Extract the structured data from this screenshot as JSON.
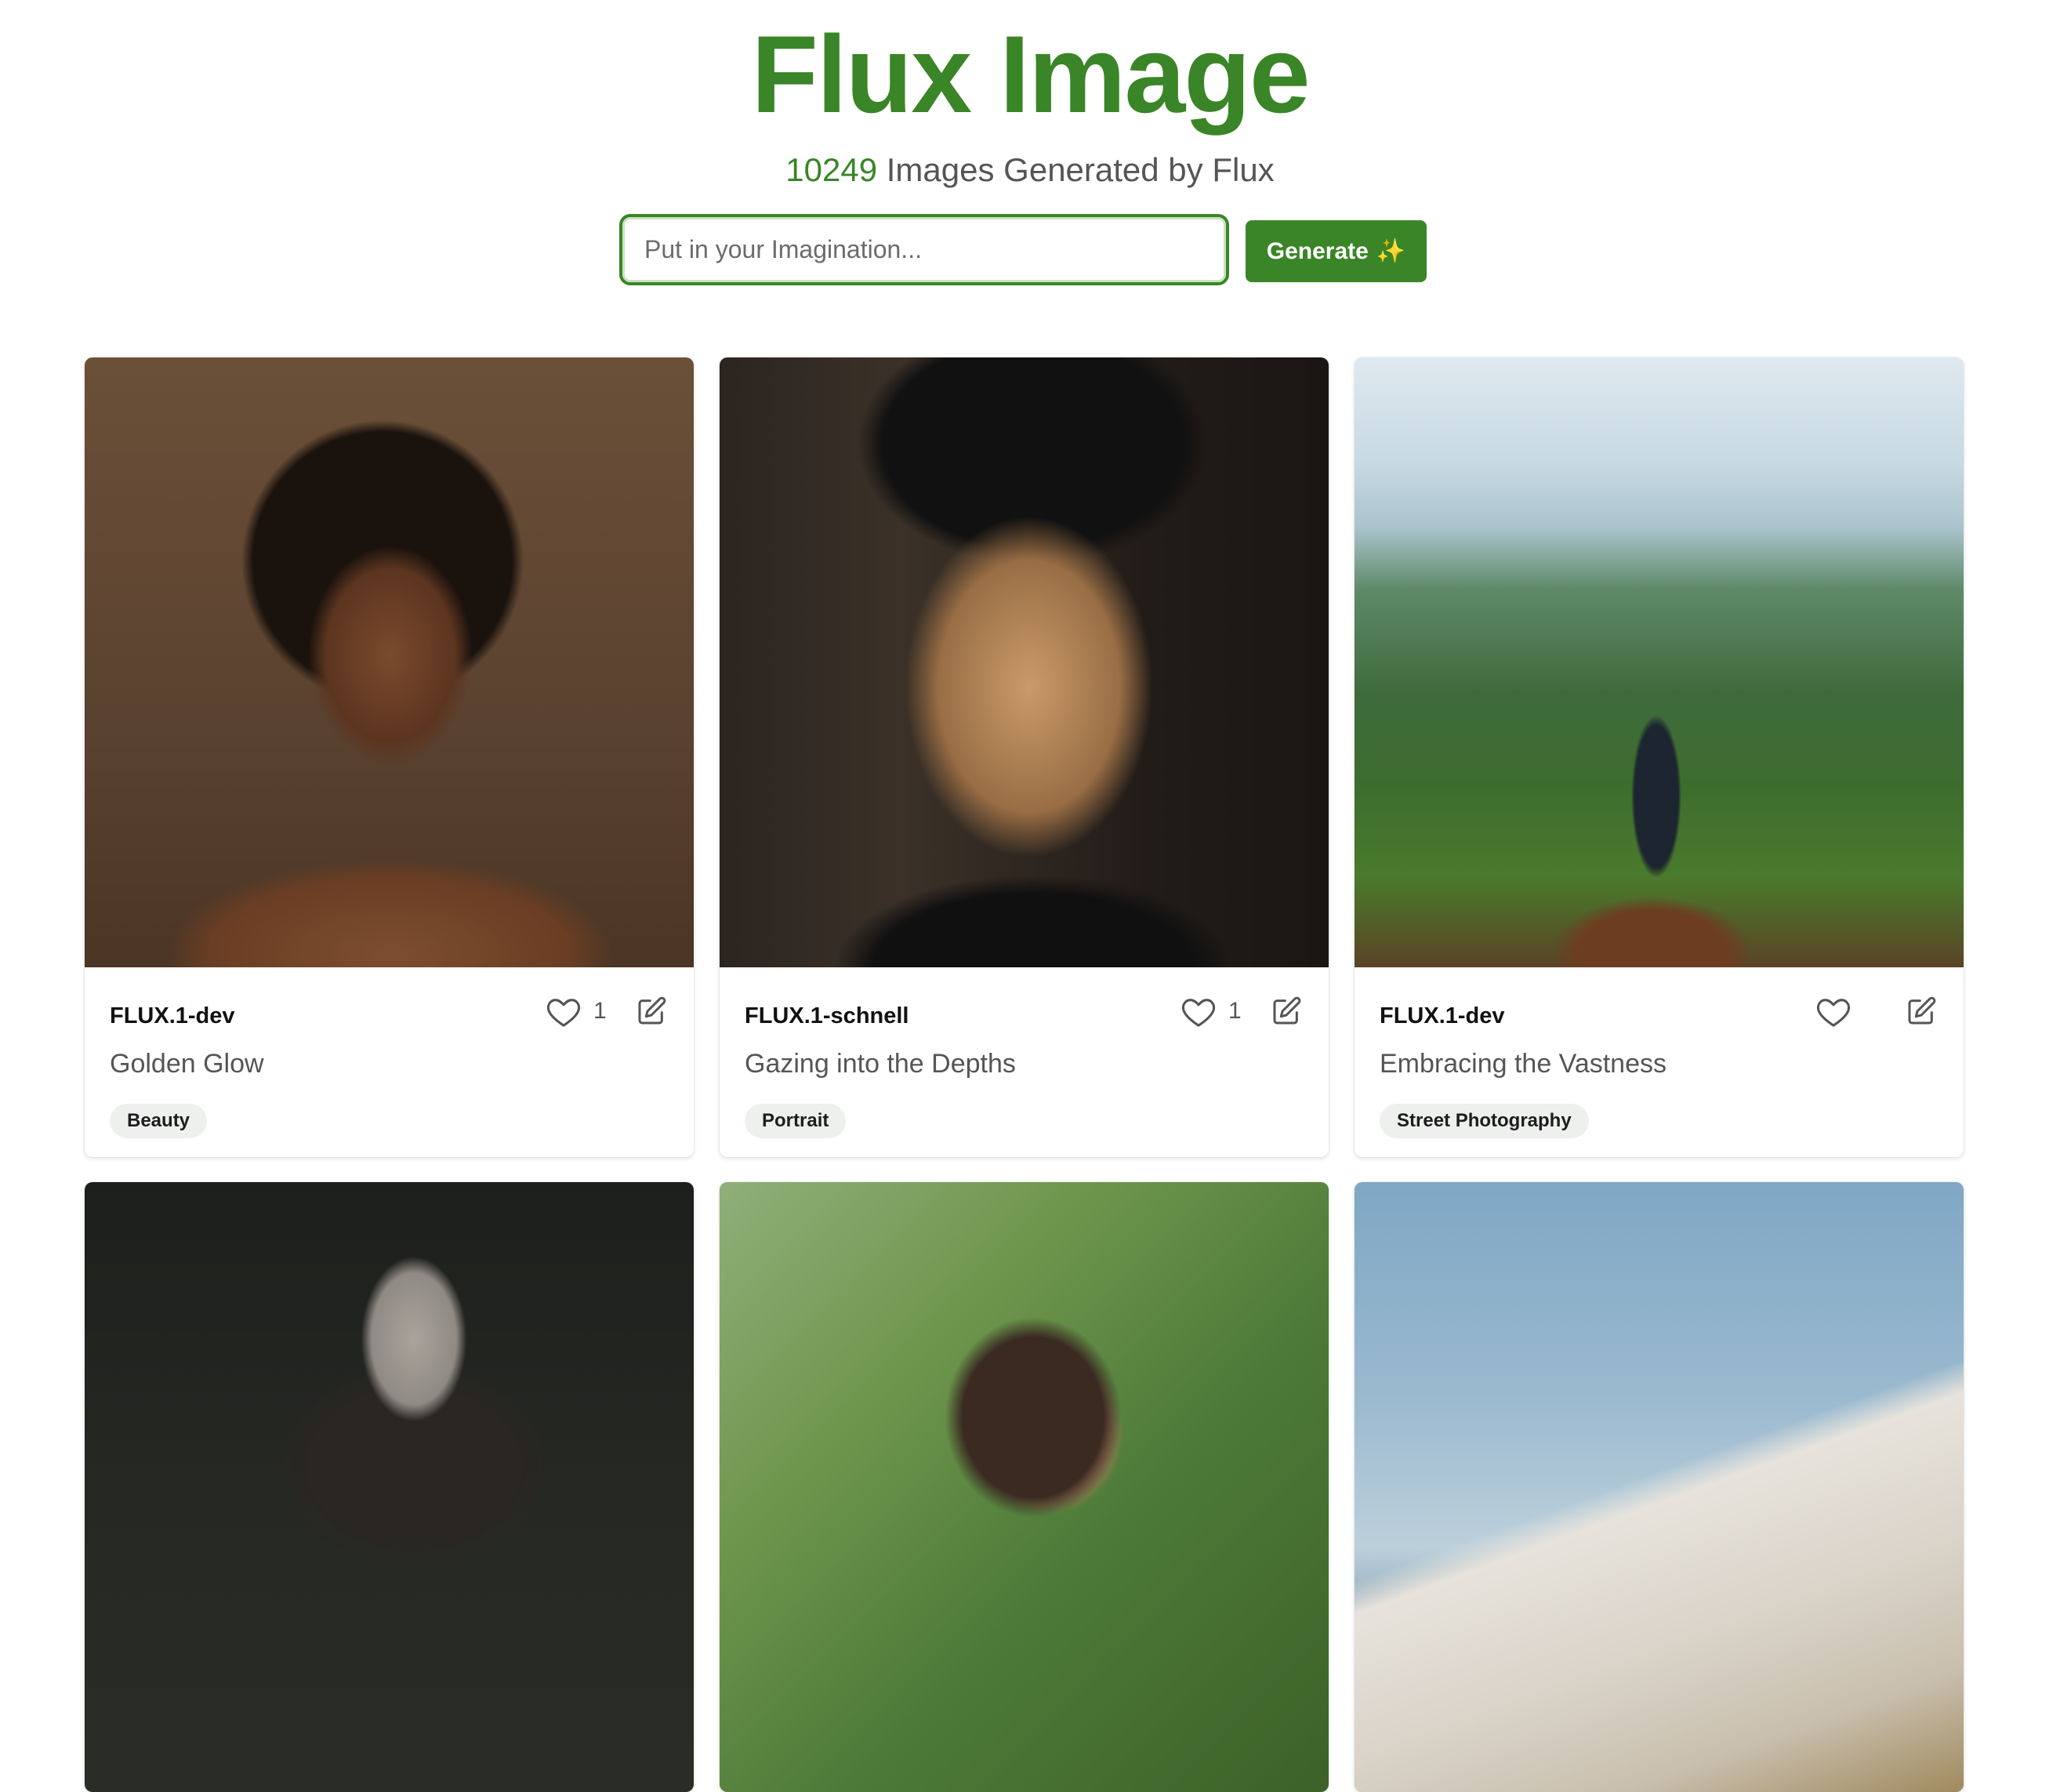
{
  "header": {
    "title": "Flux Image",
    "count": "10249",
    "subtitle_suffix": " Images Generated by Flux"
  },
  "search": {
    "placeholder": "Put in your Imagination...",
    "value": "",
    "button_label": "Generate",
    "button_icon": "sparkles-icon"
  },
  "colors": {
    "accent": "#3a8527",
    "tag_bg": "#eef0ee"
  },
  "cards": [
    {
      "model": "FLUX.1-dev",
      "caption": "Golden Glow",
      "tag": "Beauty",
      "likes": "1",
      "image": "portrait-woman-curly-hair"
    },
    {
      "model": "FLUX.1-schnell",
      "caption": "Gazing into the Depths",
      "tag": "Portrait",
      "likes": "1",
      "image": "portrait-young-man"
    },
    {
      "model": "FLUX.1-dev",
      "caption": "Embracing the Vastness",
      "tag": "Street Photography",
      "likes": "",
      "image": "hiker-mountain-valley"
    },
    {
      "image": "woman-fur-coat"
    },
    {
      "image": "woman-drinking-outdoors"
    },
    {
      "image": "white-cliffs-sea"
    }
  ]
}
